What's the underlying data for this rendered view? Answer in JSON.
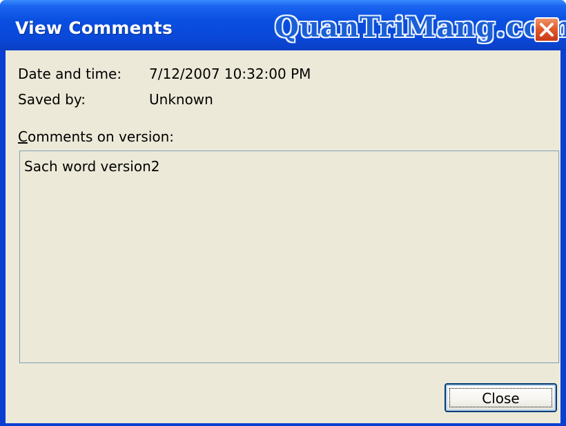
{
  "window": {
    "title": "View Comments",
    "watermark": "QuanTriMang.com"
  },
  "details": {
    "date_label": "Date and time:",
    "date_value": "7/12/2007 10:32:00 PM",
    "saved_label": "Saved by:",
    "saved_value": "Unknown"
  },
  "comments": {
    "label_accel": "C",
    "label_rest": "omments on version:",
    "text": "Sach word version2"
  },
  "buttons": {
    "close_label": "Close"
  },
  "icons": {
    "title_close": "close-icon"
  },
  "colors": {
    "titlebar": "#0a48d8",
    "client_bg": "#ece9d8",
    "close_button": "#e25a2b"
  }
}
